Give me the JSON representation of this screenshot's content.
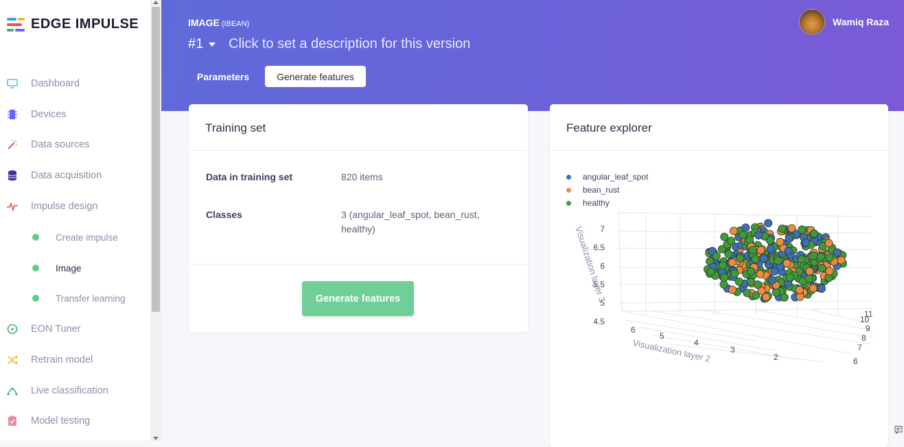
{
  "brand": {
    "name": "EDGE IMPULSE"
  },
  "sidebar": {
    "items": [
      {
        "label": "Dashboard",
        "icon": "monitor-icon",
        "color": "#5bc0de"
      },
      {
        "label": "Devices",
        "icon": "chip-icon",
        "color": "#6c63ff"
      },
      {
        "label": "Data sources",
        "icon": "magic-wand-icon",
        "color": "#e05a7a"
      },
      {
        "label": "Data acquisition",
        "icon": "database-icon",
        "color": "#4b2fa0"
      },
      {
        "label": "Impulse design",
        "icon": "pulse-icon",
        "color": "#e55353"
      },
      {
        "label": "Create impulse",
        "sub": true
      },
      {
        "label": "Image",
        "sub": true,
        "active": true
      },
      {
        "label": "Transfer learning",
        "sub": true
      },
      {
        "label": "EON Tuner",
        "icon": "compass-icon",
        "color": "#3cb371"
      },
      {
        "label": "Retrain model",
        "icon": "shuffle-icon",
        "color": "#f2b632"
      },
      {
        "label": "Live classification",
        "icon": "network-icon",
        "color": "#3cb371"
      },
      {
        "label": "Model testing",
        "icon": "clipboard-check-icon",
        "color": "#e58ca0"
      }
    ]
  },
  "header": {
    "title": "IMAGE",
    "subtitle": "(IBEAN)",
    "version": "#1",
    "description": "Click to set a description for this version",
    "tabs": {
      "parameters": "Parameters",
      "generate": "Generate features"
    },
    "user": {
      "name": "Wamiq Raza"
    }
  },
  "training": {
    "title": "Training set",
    "data_label": "Data in training set",
    "data_value": "820 items",
    "classes_label": "Classes",
    "classes_value": "3 (angular_leaf_spot, bean_rust, healthy)",
    "button": "Generate features"
  },
  "explorer": {
    "title": "Feature explorer",
    "legend": [
      {
        "name": "angular_leaf_spot",
        "color": "#3d6fb4"
      },
      {
        "name": "bean_rust",
        "color": "#ef8b3c"
      },
      {
        "name": "healthy",
        "color": "#3f9b3a"
      }
    ],
    "z_axis_label": "Visualization layer 3",
    "x_axis_label": "Visualization layer 2",
    "z_ticks": [
      "7",
      "6.5",
      "6",
      "5.5",
      "5",
      "4.5"
    ],
    "x_ticks": [
      "6",
      "5",
      "4",
      "3",
      "2"
    ],
    "y_ticks": [
      "11",
      "10",
      "9",
      "8",
      "7",
      "6"
    ]
  }
}
